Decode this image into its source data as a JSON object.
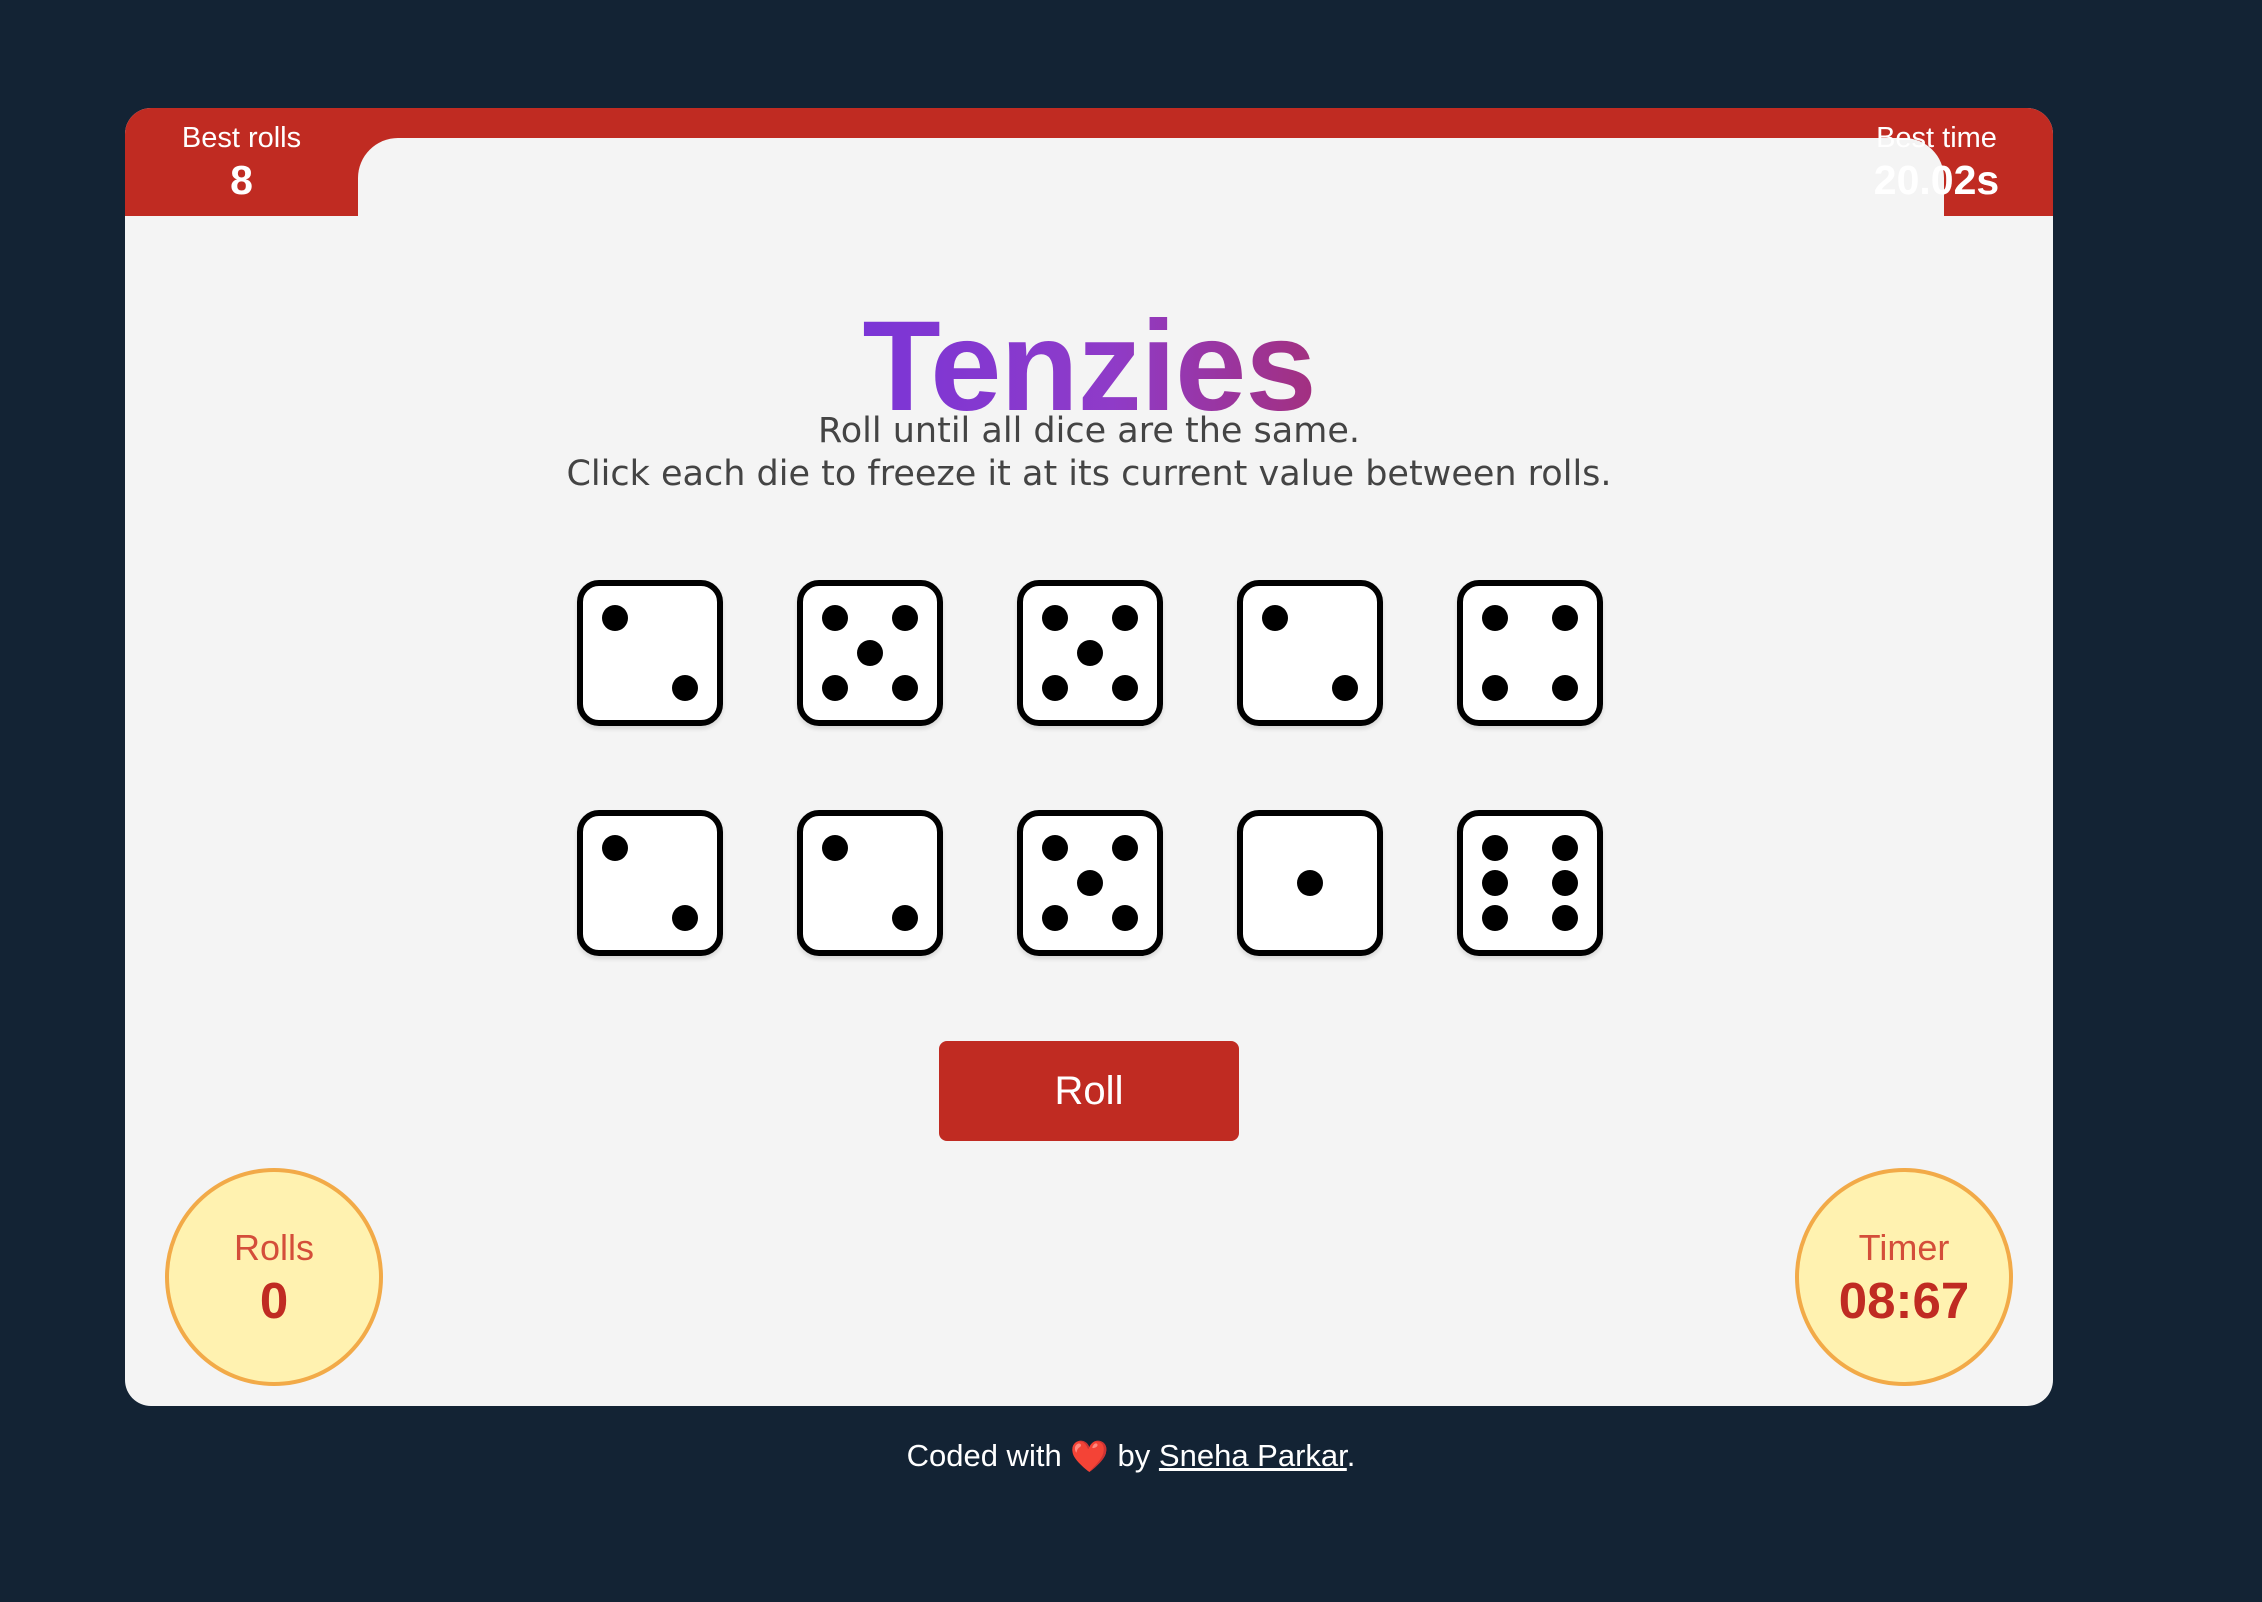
{
  "header": {
    "best_rolls_label": "Best rolls",
    "best_rolls_value": "8",
    "best_time_label": "Best time",
    "best_time_value": "20.02s"
  },
  "title": "Tenzies",
  "instructions": {
    "line1": "Roll until all dice are the same.",
    "line2": "Click each die to freeze it at its current value between rolls."
  },
  "dice": [
    2,
    5,
    5,
    2,
    4,
    2,
    2,
    5,
    1,
    6
  ],
  "roll_button_label": "Roll",
  "stats": {
    "rolls_label": "Rolls",
    "rolls_value": "0",
    "timer_label": "Timer",
    "timer_value": "08:67"
  },
  "footer": {
    "prefix": "Coded with",
    "heart_icon": "❤️",
    "by": "by",
    "author": "Sneha Parkar",
    "suffix": "."
  },
  "colors": {
    "background": "#132334",
    "card": "#f4f4f4",
    "accent_red": "#c02b22",
    "badge_fill": "#fff2b0",
    "badge_border": "#f2aa48",
    "title_gradient_start": "#7b35d6",
    "title_gradient_end": "#a3307f"
  }
}
